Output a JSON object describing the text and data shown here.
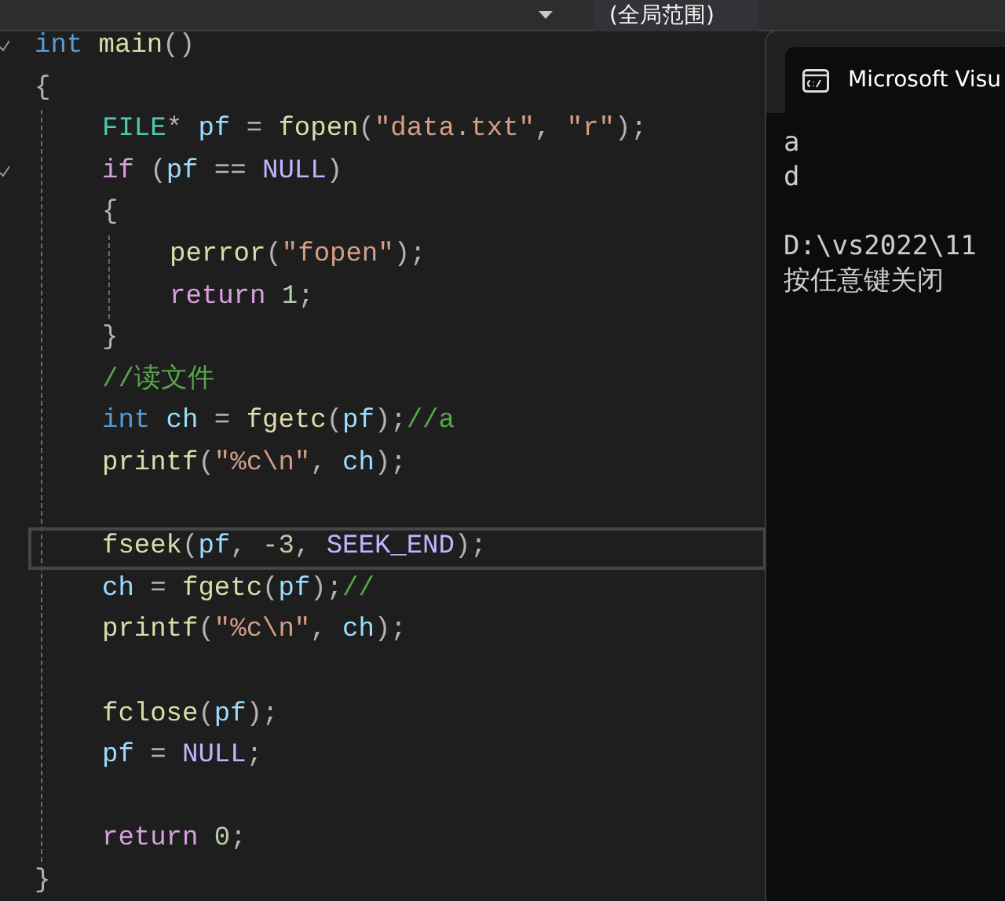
{
  "toolbar": {
    "scope_dropdown": {
      "value": "(全局范围)"
    }
  },
  "editor": {
    "lines": [
      {
        "fold_mark": true,
        "tokens": [
          {
            "text": "int",
            "kind": "keyword"
          },
          {
            "text": " main",
            "kind": "function"
          },
          {
            "text": "()"
          }
        ]
      },
      {
        "tokens": [
          {
            "text": "{"
          }
        ]
      },
      {
        "kind": "block",
        "children": [
          {
            "tokens": [
              {
                "text": "FILE",
                "kind": "type"
              },
              {
                "text": "* "
              },
              {
                "text": "pf",
                "kind": "variable"
              },
              {
                "text": " = "
              },
              {
                "text": "fopen",
                "kind": "function"
              },
              {
                "text": "("
              },
              {
                "text": "\"data.txt\"",
                "kind": "string"
              },
              {
                "text": ", "
              },
              {
                "text": "\"r\"",
                "kind": "string"
              },
              {
                "text": ");"
              }
            ]
          },
          {
            "fold_mark": true,
            "tokens": [
              {
                "text": "if",
                "kind": "control"
              },
              {
                "text": " ("
              },
              {
                "text": "pf",
                "kind": "variable"
              },
              {
                "text": " == "
              },
              {
                "text": "NULL",
                "kind": "macro"
              },
              {
                "text": ")"
              }
            ]
          },
          {
            "tokens": [
              {
                "text": "{"
              }
            ]
          },
          {
            "kind": "block",
            "children": [
              {
                "tokens": [
                  {
                    "text": "perror",
                    "kind": "function"
                  },
                  {
                    "text": "("
                  },
                  {
                    "text": "\"fopen\"",
                    "kind": "string"
                  },
                  {
                    "text": ");"
                  }
                ]
              },
              {
                "tokens": [
                  {
                    "text": "return",
                    "kind": "control"
                  },
                  {
                    "text": " 1",
                    "kind": "number"
                  },
                  {
                    "text": ";"
                  }
                ]
              }
            ]
          },
          {
            "tokens": [
              {
                "text": "}"
              }
            ]
          },
          {
            "tokens": [
              {
                "text": "//读文件",
                "kind": "comment"
              }
            ]
          },
          {
            "tokens": [
              {
                "text": "int",
                "kind": "keyword"
              },
              {
                "text": " ch",
                "kind": "variable"
              },
              {
                "text": " = "
              },
              {
                "text": "fgetc",
                "kind": "function"
              },
              {
                "text": "("
              },
              {
                "text": "pf",
                "kind": "variable"
              },
              {
                "text": ");"
              },
              {
                "text": "//a",
                "kind": "comment"
              }
            ]
          },
          {
            "tokens": [
              {
                "text": "printf",
                "kind": "function"
              },
              {
                "text": "("
              },
              {
                "text": "\"%c\\n\"",
                "kind": "string"
              },
              {
                "text": ", "
              },
              {
                "text": "ch",
                "kind": "variable"
              },
              {
                "text": ");"
              }
            ]
          },
          {
            "kind": "blank"
          },
          {
            "current": true,
            "tokens": [
              {
                "text": "fseek",
                "kind": "function"
              },
              {
                "text": "("
              },
              {
                "text": "pf",
                "kind": "variable"
              },
              {
                "text": ", "
              },
              {
                "text": "-3",
                "kind": "number"
              },
              {
                "text": ", "
              },
              {
                "text": "SEEK_END",
                "kind": "macro"
              },
              {
                "text": ");"
              }
            ]
          },
          {
            "tokens": [
              {
                "text": "ch",
                "kind": "variable"
              },
              {
                "text": " = "
              },
              {
                "text": "fgetc",
                "kind": "function"
              },
              {
                "text": "("
              },
              {
                "text": "pf",
                "kind": "variable"
              },
              {
                "text": ");"
              },
              {
                "text": "//",
                "kind": "comment"
              }
            ]
          },
          {
            "tokens": [
              {
                "text": "printf",
                "kind": "function"
              },
              {
                "text": "("
              },
              {
                "text": "\"%c\\n\"",
                "kind": "string"
              },
              {
                "text": ", "
              },
              {
                "text": "ch",
                "kind": "variable"
              },
              {
                "text": ");"
              }
            ]
          },
          {
            "kind": "blank"
          },
          {
            "tokens": [
              {
                "text": "fclose",
                "kind": "function"
              },
              {
                "text": "("
              },
              {
                "text": "pf",
                "kind": "variable"
              },
              {
                "text": ");"
              }
            ]
          },
          {
            "tokens": [
              {
                "text": "pf",
                "kind": "variable"
              },
              {
                "text": " = "
              },
              {
                "text": "NULL",
                "kind": "macro"
              },
              {
                "text": ";"
              }
            ]
          },
          {
            "kind": "blank"
          },
          {
            "tokens": [
              {
                "text": "return",
                "kind": "control"
              },
              {
                "text": " 0",
                "kind": "number"
              },
              {
                "text": ";"
              }
            ]
          }
        ]
      },
      {
        "tokens": [
          {
            "text": "}"
          }
        ]
      }
    ]
  },
  "console": {
    "title": "Microsoft Visu",
    "output_paragraphs": [
      {
        "lines": [
          "a",
          "d"
        ]
      },
      {
        "lines": [
          "D:\\vs2022\\11",
          "按任意键关闭"
        ]
      }
    ]
  }
}
